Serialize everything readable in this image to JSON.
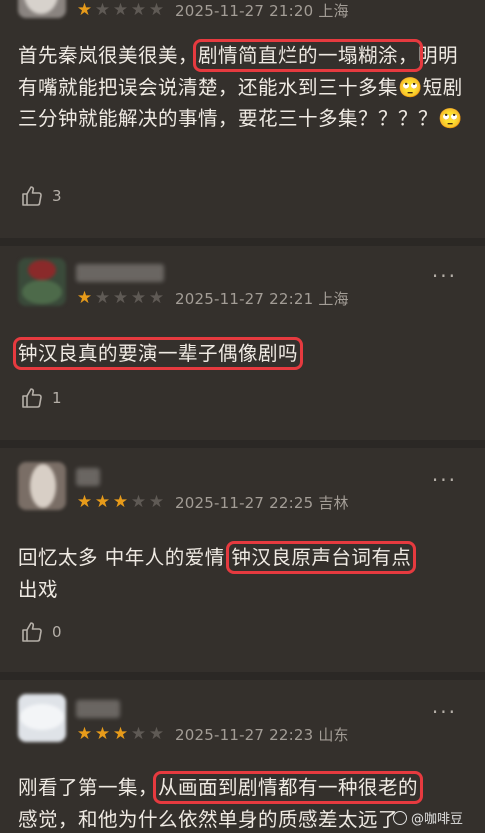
{
  "reviews": [
    {
      "rating": 1,
      "stars_text": [
        "★",
        "★",
        "★",
        "★",
        "★"
      ],
      "time": "2025-11-27 21:20",
      "location": "上海",
      "content_pre": "首先秦岚很美很美，",
      "content_hl": "剧情简直烂的一塌糊涂，",
      "content_post": "明明有嘴就能把误会说清楚，还能水到三十多集🙄短剧三分钟就能解决的事情，要花三十多集？？？？🙄",
      "likes": "3"
    },
    {
      "rating": 1,
      "time": "2025-11-27 22:21",
      "location": "上海",
      "content_pre": "",
      "content_hl": "钟汉良真的要演一辈子偶像剧吗",
      "content_post": "",
      "likes": "1",
      "more_label": "···"
    },
    {
      "rating": 3,
      "time": "2025-11-27 22:25",
      "location": "吉林",
      "content_pre": "回忆太多 中年人的爱情",
      "content_hl": "钟汉良原声台词有点",
      "content_hl2": "出戏",
      "likes": "0",
      "more_label": "···"
    },
    {
      "rating": 3,
      "time": "2025-11-27 22:23",
      "location": "山东",
      "content_pre": "刚看了第一集，",
      "content_hl": "从画面到剧情都有一种很老的",
      "content_post": "感觉，和他为什么依然单身的质感差太远了",
      "more_label": "···"
    }
  ],
  "star_char": "★",
  "colors": {
    "background": "#34302c",
    "star_on": "#e79b1a",
    "star_off": "#5f5a55",
    "highlight": "#e63a3f"
  },
  "icons": {
    "like": "thumbs-up-icon",
    "more": "more-dots-icon"
  },
  "watermark": "@咖啡豆"
}
